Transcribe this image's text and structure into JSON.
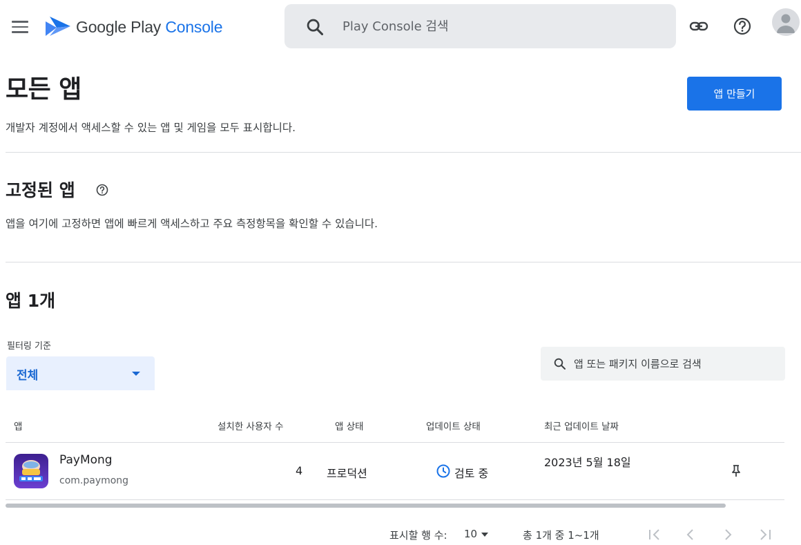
{
  "header": {
    "brand_part1": "Google Play",
    "brand_part2": "Console",
    "search_placeholder": "Play Console 검색"
  },
  "page": {
    "title": "모든 앱",
    "description": "개발자 계정에서 액세스할 수 있는 앱 및 게임을 모두 표시합니다.",
    "create_button": "앱 만들기"
  },
  "pinned": {
    "title": "고정된 앱",
    "description": "앱을 여기에 고정하면 앱에 빠르게 액세스하고 주요 측정항목을 확인할 수 있습니다."
  },
  "apps": {
    "title": "앱 1개",
    "filter_label": "필터링 기준",
    "filter_value": "전체",
    "search_placeholder": "앱 또는 패키지 이름으로 검색",
    "columns": [
      "앱",
      "설치한 사용자 수",
      "앱 상태",
      "업데이트 상태",
      "최근 업데이트 날짜"
    ],
    "rows": [
      {
        "name": "PayMong",
        "package": "com.paymong",
        "installs": "4",
        "app_status": "프로덕션",
        "update_status": "검토 중",
        "last_updated": "2023년 5월 18일"
      }
    ]
  },
  "pagination": {
    "rows_label": "표시할 행 수:",
    "rows_value": "10",
    "range_text": "총 1개 중 1~1개"
  },
  "colors": {
    "primary": "#1a73e8",
    "filter_bg": "#e8f0fe"
  }
}
